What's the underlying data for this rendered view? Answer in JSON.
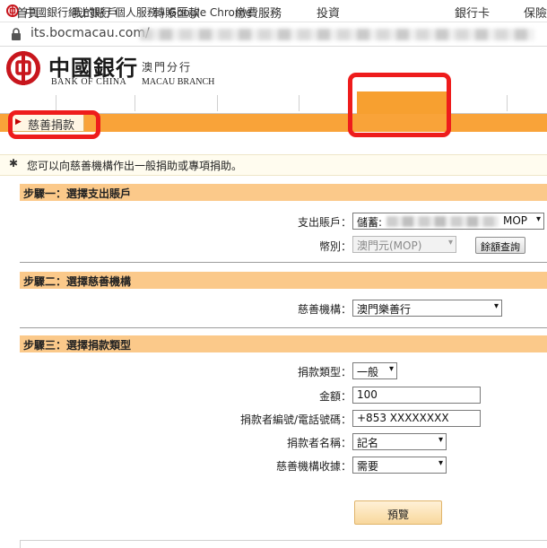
{
  "browser": {
    "window_title": "中國銀行網上銀行 個人服務 - Google Chrome",
    "url": "its.bocmacau.com/"
  },
  "bank": {
    "name_cn": "中國銀行",
    "branch_cn": "澳門分行",
    "name_en": "BANK OF CHINA",
    "branch_en": "MACAU BRANCH",
    "brand_color": "#c8161d"
  },
  "nav": {
    "items": [
      {
        "label": "首頁"
      },
      {
        "label": "我的賬戶"
      },
      {
        "label": "轉賬匯款"
      },
      {
        "label": "繳費服務"
      },
      {
        "label": "投資"
      },
      {
        "label": "慈善捐款",
        "active": true
      },
      {
        "label": "銀行卡"
      },
      {
        "label": "保險"
      }
    ],
    "active_color": "#f7a030"
  },
  "subnav": {
    "active_label": "慈善捐款",
    "arrow_icon": "triangle-right-icon"
  },
  "notice": {
    "icon": "pin-icon",
    "text": "您可以向慈善機構作出一般捐助或專項捐助。"
  },
  "step1": {
    "title": "步驟一：選擇支出賬戶",
    "account_label": "支出賬戶：",
    "account_value_prefix": "儲蓄:",
    "account_value_suffix": "MOP",
    "currency_label": "幣別：",
    "currency_value": "澳門元(MOP)",
    "balance_button": "餘額查詢"
  },
  "step2": {
    "title": "步驟二：選擇慈善機構",
    "charity_label": "慈善機構：",
    "charity_value": "澳門樂善行"
  },
  "step3": {
    "title": "步驟三：選擇捐款類型",
    "type_label": "捐款類型：",
    "type_value": "一般",
    "amount_label": "金額：",
    "amount_value": "100",
    "donor_id_label": "捐款者編號/電話號碼：",
    "donor_id_value": "+853 XXXXXXXX",
    "donor_name_label": "捐款者名稱：",
    "donor_name_value": "記名",
    "receipt_label": "慈善機構收據：",
    "receipt_value": "需要"
  },
  "actions": {
    "preview_button": "預覽"
  },
  "colors": {
    "orange_bar": "#f9a339",
    "section_header": "#fbc98a",
    "highlight_red": "#ee1c1c"
  }
}
